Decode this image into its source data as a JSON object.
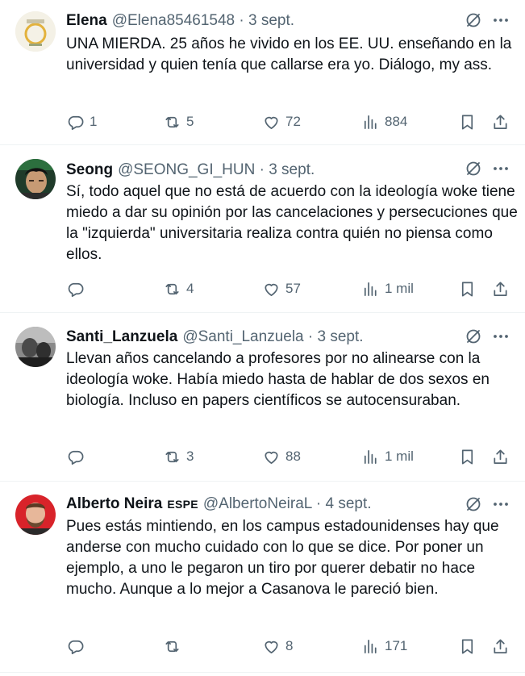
{
  "tweets": [
    {
      "name": "Elena",
      "badge": "",
      "handle": "@Elena85461548 · 3 sept.",
      "text": "UNA MIERDA. 25 años he vivido en los EE. UU. enseñando en la universidad y quien tenía que callarse era yo. Diálogo, my ass.",
      "replies": "1",
      "reposts": "5",
      "likes": "72",
      "views": "884"
    },
    {
      "name": "Seong",
      "badge": "",
      "handle": "@SEONG_GI_HUN · 3 sept.",
      "text": "Sí, todo aquel que no está de acuerdo con la ideología woke tiene miedo a dar su opinión por las cancelaciones y persecuciones que la \"izquierda\" universitaria realiza contra quién no piensa como ellos.",
      "replies": "",
      "reposts": "4",
      "likes": "57",
      "views": "1 mil"
    },
    {
      "name": "Santi_Lanzuela",
      "badge": "",
      "handle": "@Santi_Lanzuela · 3 sept.",
      "text": "Llevan años cancelando a profesores por no alinearse con la ideología woke. Había miedo hasta de hablar de dos sexos en biología. Incluso en papers científicos se autocensuraban.",
      "replies": "",
      "reposts": "3",
      "likes": "88",
      "views": "1 mil"
    },
    {
      "name": "Alberto Neira",
      "badge": "ESPE",
      "handle": "@AlbertoNeiraL · 4 sept.",
      "text": "Pues estás mintiendo, en los campus estadounidenses hay que anderse con mucho cuidado con lo que se dice. Por poner un ejemplo, a uno le pegaron un tiro por querer debatir no hace mucho. Aunque a lo mejor a Casanova le pareció bien.",
      "replies": "",
      "reposts": "",
      "likes": "8",
      "views": "171"
    }
  ],
  "colors": {
    "text": "#0f1419",
    "secondary": "#536471",
    "divider": "#eff3f4"
  },
  "icons": [
    "reply-icon",
    "repost-icon",
    "like-icon",
    "views-icon",
    "bookmark-icon",
    "share-icon",
    "grok-icon",
    "more-icon"
  ]
}
